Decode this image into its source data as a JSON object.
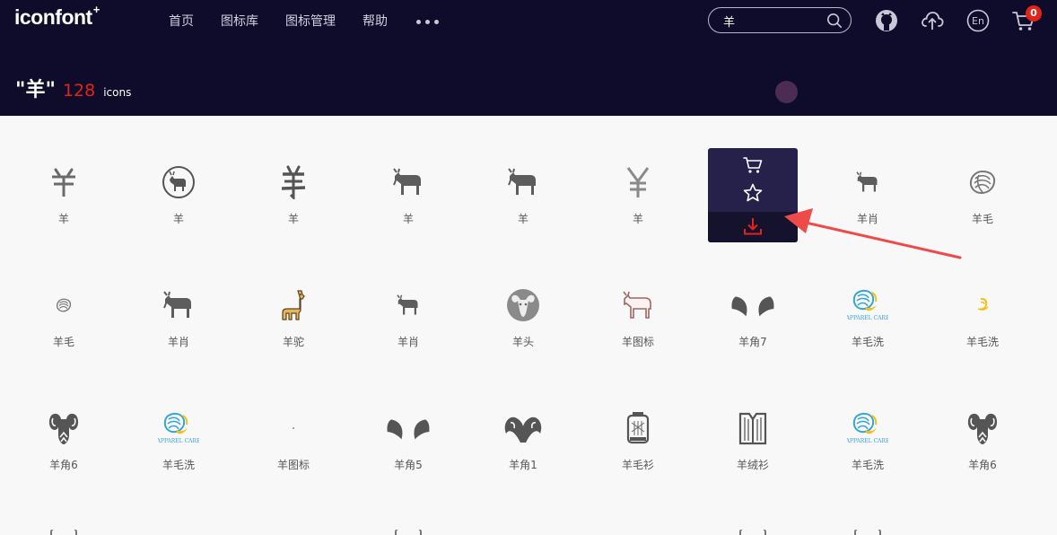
{
  "header": {
    "logo": "iconfont",
    "logo_mark": "+",
    "nav": [
      "首页",
      "图标库",
      "图标管理",
      "帮助"
    ],
    "search": {
      "value": "羊"
    },
    "cart_count": "0",
    "lang_label": "En",
    "brand_color": "#0f0c2b",
    "accent_color": "#e2231a"
  },
  "result": {
    "query": "\"羊\"",
    "count": "128",
    "unit": "icons"
  },
  "icons": [
    {
      "name": "羊",
      "icon": "yen-char-icon"
    },
    {
      "name": "羊",
      "icon": "goat-circle-icon"
    },
    {
      "name": "羊",
      "icon": "yang-char-icon"
    },
    {
      "name": "羊",
      "icon": "goat-icon"
    },
    {
      "name": "羊",
      "icon": "goat-icon"
    },
    {
      "name": "羊",
      "icon": "yen-thin-icon"
    },
    {
      "name": "",
      "icon": "hover-target-icon"
    },
    {
      "name": "羊肖",
      "icon": "goat-small-icon"
    },
    {
      "name": "羊毛",
      "icon": "wool-ball-icon"
    },
    {
      "name": "羊毛",
      "icon": "wool-ball-small-icon"
    },
    {
      "name": "羊肖",
      "icon": "goat-icon"
    },
    {
      "name": "羊驼",
      "icon": "alpaca-icon"
    },
    {
      "name": "羊肖",
      "icon": "goat-small-icon"
    },
    {
      "name": "羊头",
      "icon": "ram-head-icon"
    },
    {
      "name": "羊图标",
      "icon": "goat-outline-icon"
    },
    {
      "name": "羊角7",
      "icon": "horns-icon"
    },
    {
      "name": "羊毛洗",
      "icon": "wool-wash-icon"
    },
    {
      "name": "羊毛洗",
      "icon": "wool-wash-small-icon"
    },
    {
      "name": "羊角6",
      "icon": "ram-face-icon"
    },
    {
      "name": "羊毛洗",
      "icon": "wool-wash-icon"
    },
    {
      "name": "羊图标",
      "icon": "tiny-mark-icon"
    },
    {
      "name": "羊角5",
      "icon": "horns-icon"
    },
    {
      "name": "羊角1",
      "icon": "ram-horns-icon"
    },
    {
      "name": "羊毛衫",
      "icon": "sweater-icon"
    },
    {
      "name": "羊绒衫",
      "icon": "cardigan-icon"
    },
    {
      "name": "羊毛洗",
      "icon": "wool-wash-icon"
    },
    {
      "name": "羊角6",
      "icon": "ram-face-icon"
    }
  ],
  "wool_label": "APPAREL CARE"
}
